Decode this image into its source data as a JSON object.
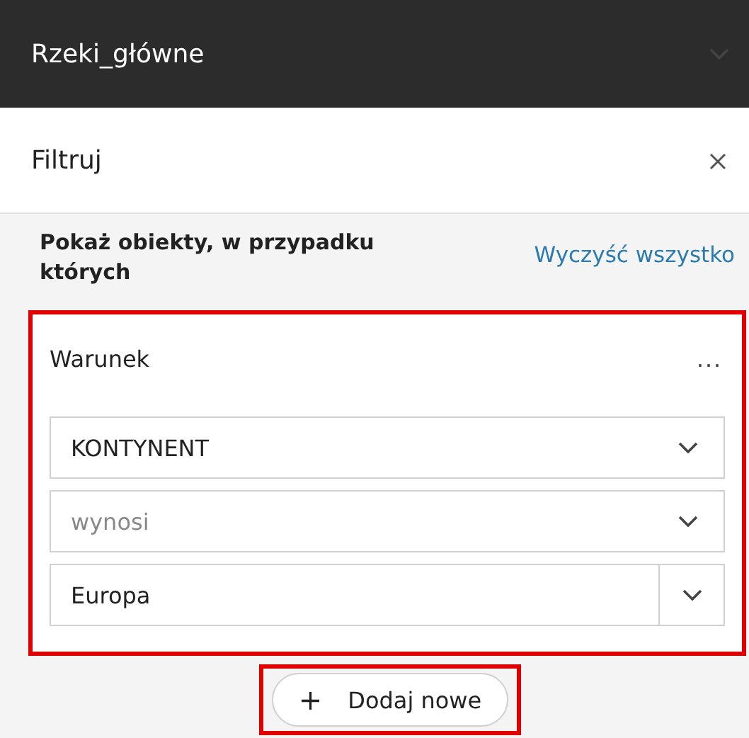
{
  "header": {
    "title": "Rzeki_główne"
  },
  "panel": {
    "title": "Filtruj"
  },
  "prompt": "Pokaż obiekty, w przypadku których",
  "clear_link": "Wyczyść wszystko",
  "condition": {
    "title": "Warunek",
    "menu": "...",
    "fields": [
      {
        "kind": "select",
        "value": "KONTYNENT",
        "disabled": false
      },
      {
        "kind": "select",
        "value": "wynosi",
        "disabled": true
      },
      {
        "kind": "combo",
        "value": "Europa",
        "disabled": false
      }
    ]
  },
  "add_button": {
    "icon": "+",
    "label": "Dodaj nowe"
  }
}
